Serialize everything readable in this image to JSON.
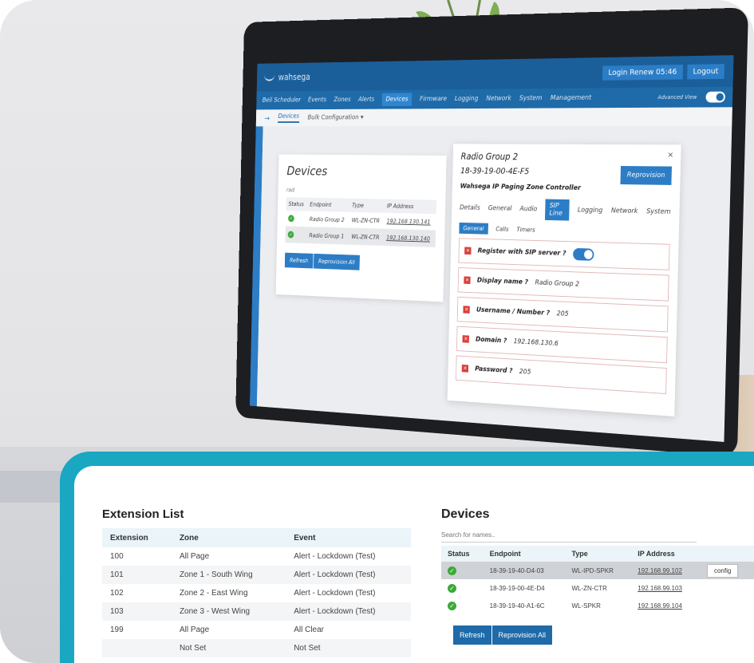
{
  "laptop_app": {
    "brand": "wahsega",
    "topbar_buttons": [
      "Login Renew 05:46",
      "Logout"
    ],
    "nav_items": [
      "Bell Scheduler",
      "Events",
      "Zones",
      "Alerts",
      "Devices",
      "Firmware",
      "Logging",
      "Network",
      "System",
      "Management"
    ],
    "nav_active": "Devices",
    "advanced_view_label": "Advanced View",
    "subnav": [
      "Devices",
      "Bulk Configuration"
    ],
    "devices_panel": {
      "title": "Devices",
      "filter": "rad",
      "headers": [
        "Status",
        "Endpoint",
        "Type",
        "IP Address"
      ],
      "rows": [
        {
          "endpoint": "Radio Group 2",
          "type": "WL-ZN-CTR",
          "ip": "192.168.130.141"
        },
        {
          "endpoint": "Radio Group 1",
          "type": "WL-ZN-CTR",
          "ip": "192.168.130.140"
        }
      ],
      "buttons": [
        "Refresh",
        "Reprovision All"
      ]
    },
    "detail_panel": {
      "title": "Radio Group 2",
      "mac": "18-39-19-00-4E-F5",
      "model": "Wahsega IP Paging Zone Controller",
      "reprovision": "Reprovision",
      "tabs": [
        "Details",
        "General",
        "Audio",
        "SIP Line",
        "Logging",
        "Network",
        "System"
      ],
      "tab_active": "SIP Line",
      "subtabs": [
        "General",
        "Calls",
        "Timers"
      ],
      "subtab_active": "General",
      "fields": [
        {
          "label": "Register with SIP server",
          "value": ""
        },
        {
          "label": "Display name",
          "value": "Radio Group 2"
        },
        {
          "label": "Username / Number",
          "value": "205"
        },
        {
          "label": "Domain",
          "value": "192.168.130.6"
        },
        {
          "label": "Password",
          "value": "205"
        }
      ]
    }
  },
  "extension_list": {
    "title": "Extension List",
    "headers": [
      "Extension",
      "Zone",
      "Event"
    ],
    "rows": [
      [
        "100",
        "All Page",
        "Alert - Lockdown (Test)"
      ],
      [
        "101",
        "Zone 1 - South Wing",
        "Alert - Lockdown (Test)"
      ],
      [
        "102",
        "Zone 2 - East Wing",
        "Alert - Lockdown (Test)"
      ],
      [
        "103",
        "Zone 3 - West Wing",
        "Alert - Lockdown (Test)"
      ],
      [
        "199",
        "All Page",
        "All Clear"
      ],
      [
        "",
        "Not Set",
        "Not Set"
      ]
    ]
  },
  "devices": {
    "title": "Devices",
    "search_placeholder": "Search for names..",
    "headers": [
      "Status",
      "Endpoint",
      "Type",
      "IP Address"
    ],
    "rows": [
      {
        "endpoint": "18-39-19-40-D4-03",
        "type": "WL-IPD-SPKR",
        "ip": "192.168.99.102",
        "action": "config"
      },
      {
        "endpoint": "18-39-19-00-4E-D4",
        "type": "WL-ZN-CTR",
        "ip": "192.168.99.103",
        "action": ""
      },
      {
        "endpoint": "18-39-19-40-A1-6C",
        "type": "WL-SPKR",
        "ip": "192.168.99.104",
        "action": ""
      }
    ],
    "buttons": [
      "Refresh",
      "Reprovision All"
    ]
  },
  "colors": {
    "card_border": "#19a7c2",
    "brand_blue": "#1f6aa8",
    "status_ok": "#3aaa35",
    "error_red": "#d9403a"
  }
}
